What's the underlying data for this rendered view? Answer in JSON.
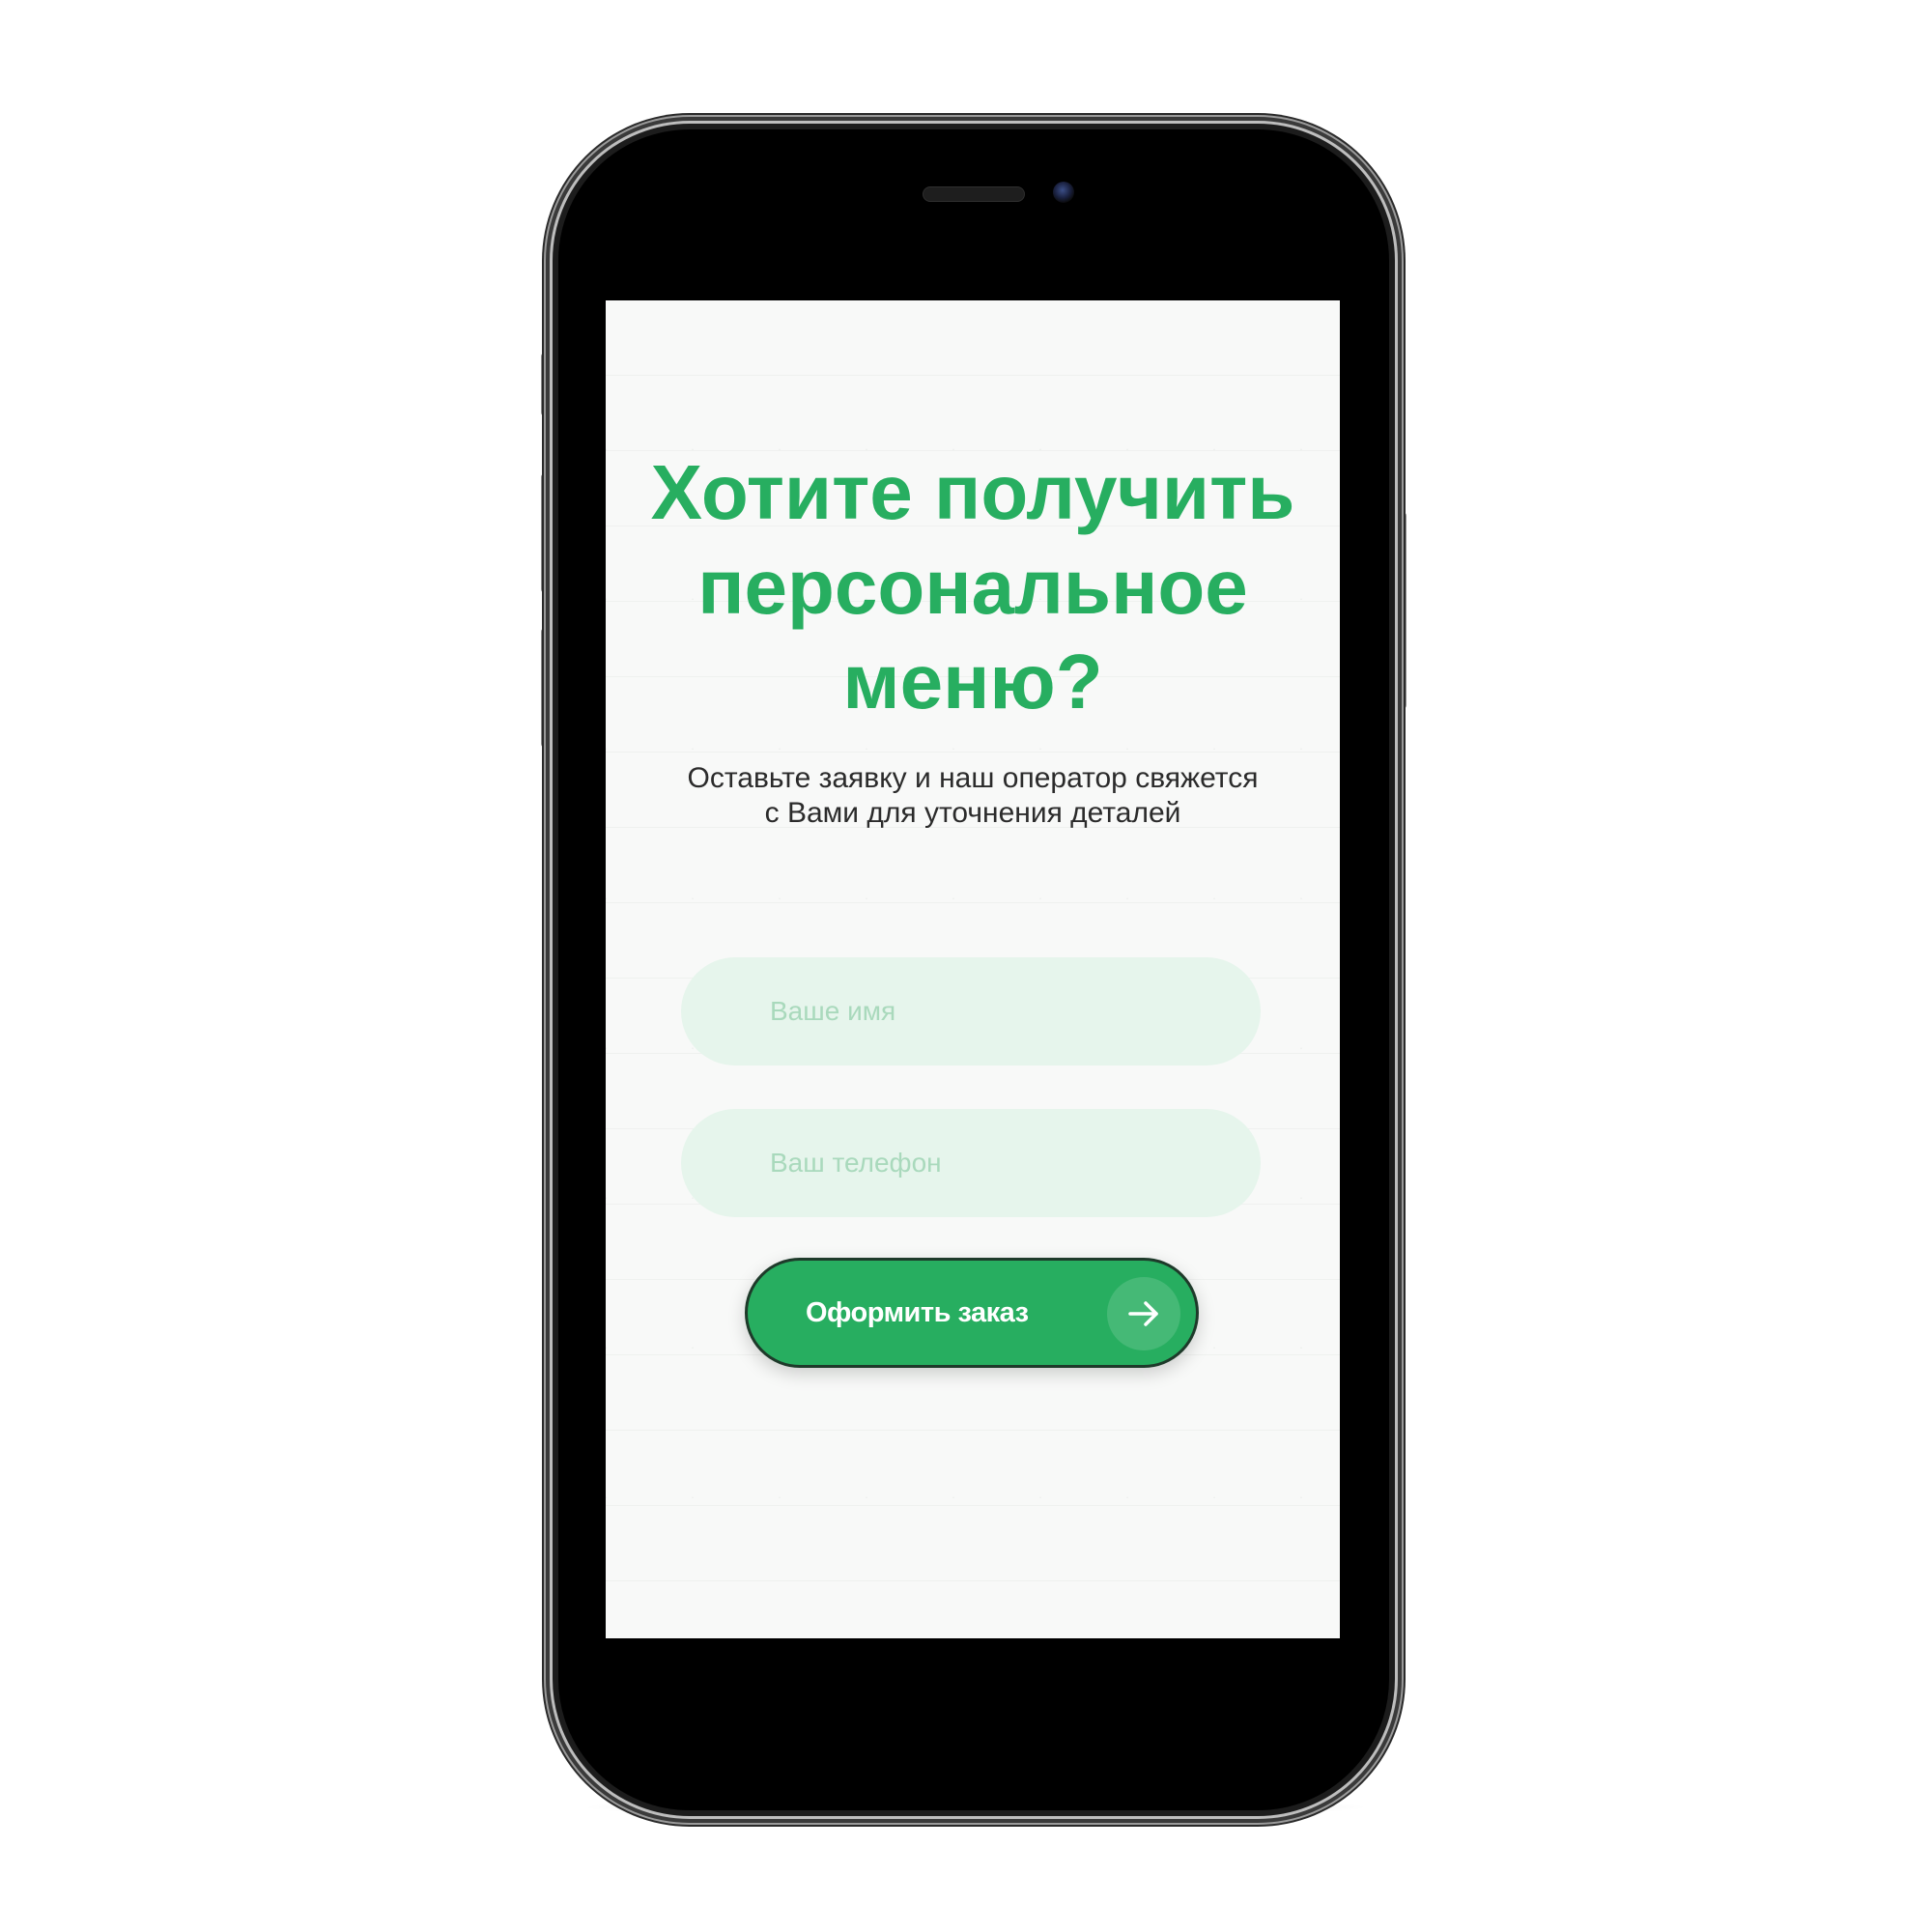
{
  "form": {
    "headline_line1": "Хотите получить",
    "headline_line2": "персональное",
    "headline_line3": "меню?",
    "subtitle_line1": "Оставьте заявку и наш оператор свяжется",
    "subtitle_line2": "с Вами для уточнения деталей",
    "name_placeholder": "Ваше имя",
    "name_value": "",
    "phone_placeholder": "Ваш телефон",
    "phone_value": "",
    "submit_label": "Оформить заказ",
    "submit_icon": "arrow-right-icon"
  },
  "colors": {
    "accent": "#27ae60",
    "field_background": "#e6f5ec",
    "placeholder": "#a9d9bc",
    "body_text": "#2b2b2b",
    "screen_background": "#f8f9f8"
  }
}
